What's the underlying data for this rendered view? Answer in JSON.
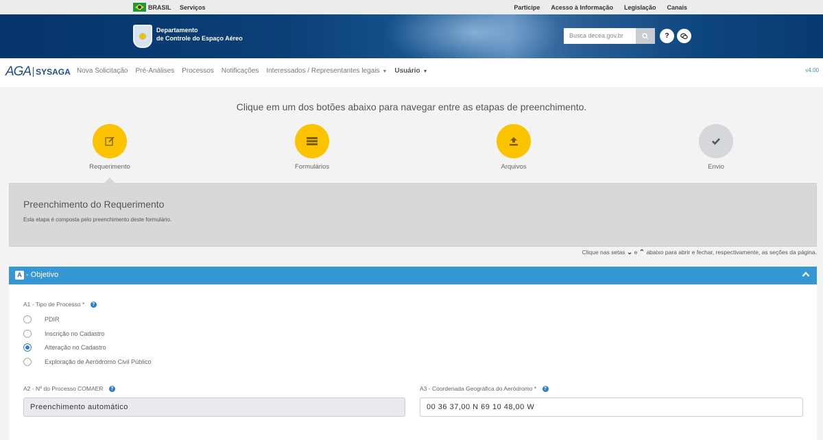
{
  "gov_bar": {
    "brasil": "BRASIL",
    "servicos": "Serviços",
    "links": [
      "Participe",
      "Acesso à Informação",
      "Legislação",
      "Canais"
    ]
  },
  "header": {
    "dept_line1": "Departamento",
    "dept_line2": "de Controle do Espaço Aéreo",
    "search_placeholder": "Busca decea.gov.br",
    "help_icon": "?",
    "chat_icon": "chat-icon"
  },
  "nav": {
    "brand_aga": "AGA",
    "brand_sys": "SYSAGA",
    "items": [
      "Nova Solicitação",
      "Pré-Análises",
      "Processos",
      "Notificações",
      "Interessados / Representantes legais",
      "Usuário"
    ],
    "version": "v4.00"
  },
  "steps": {
    "instruction": "Clique em um dos botões abaixo para navegar entre as etapas de preenchimento.",
    "items": [
      {
        "label": "Requerimento",
        "icon": "edit-icon"
      },
      {
        "label": "Formulários",
        "icon": "list-icon"
      },
      {
        "label": "Arquivos",
        "icon": "upload-icon"
      },
      {
        "label": "Envio",
        "icon": "check-icon"
      }
    ]
  },
  "panel": {
    "title": "Preenchimento do Requerimento",
    "description": "Esta etapa é composta pelo preenchimento deste formulário."
  },
  "hint": {
    "part1": "Clique nas setas",
    "part2": "e",
    "part3": "abaixo para abrir e fechar, respectivamente, as seções da página."
  },
  "section": {
    "badge": "A",
    "title": "- Objetivo",
    "a1_label": "A1 - Tipo de Processo",
    "required_mark": "*",
    "options": [
      "PDIR",
      "Inscrição no Cadastro",
      "Alteração no Cadastro",
      "Exploração de Aeródromo Civil Público"
    ],
    "selected_option": "Alteração no Cadastro",
    "a2_label": "A2 - Nº do Processo COMAER",
    "a2_value": "Preenchimento automático",
    "a3_label": "A3 - Coordenada Geográfica do Aeródromo",
    "a3_value": "00 36 37,00 N 69 10 48,00 W"
  },
  "colors": {
    "accent_yellow": "#fbc300",
    "section_blue": "#3597d3",
    "header_navy": "#06356b"
  }
}
